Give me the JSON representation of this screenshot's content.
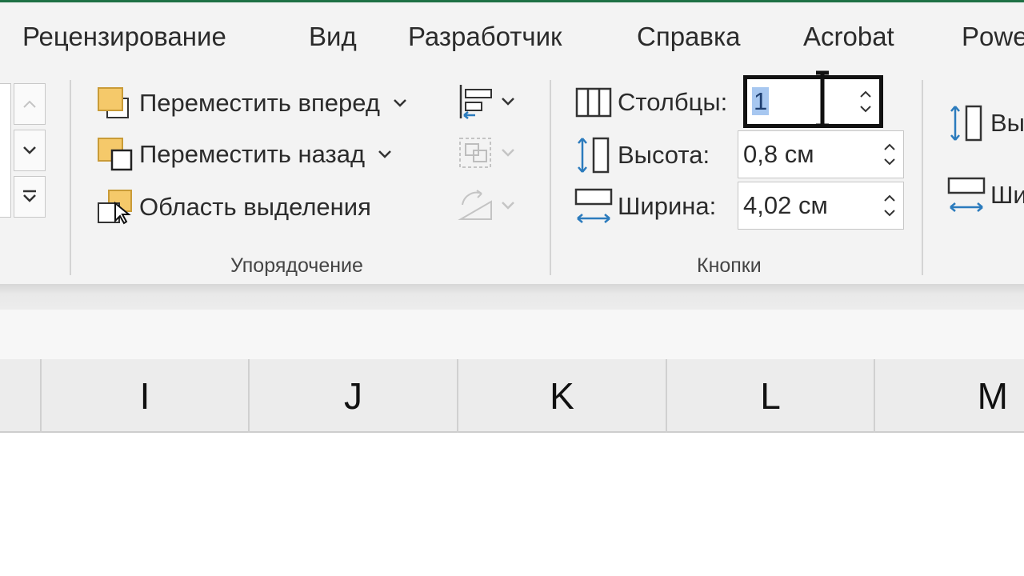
{
  "tabs": [
    "Рецензирование",
    "Вид",
    "Разработчик",
    "Справка",
    "Acrobat",
    "Powe"
  ],
  "arrange": {
    "bring_forward": "Переместить вперед",
    "send_backward": "Переместить назад",
    "selection_pane": "Область выделения",
    "group_label": "Упорядочение"
  },
  "buttons_group": {
    "columns_label": "Столбцы:",
    "columns_value": "1",
    "height_label": "Высота:",
    "height_value": "0,8 см",
    "width_label": "Ширина:",
    "width_value": "4,02 см",
    "group_label": "Кнопки"
  },
  "size_group": {
    "height_label_partial": "Вы",
    "width_label_partial": "Ши"
  },
  "columns": [
    "I",
    "J",
    "K",
    "L",
    "M"
  ],
  "colors": {
    "accent": "#1e7145",
    "ribbon_bg": "#f3f3f3",
    "icon_gold": "#f5c96a",
    "icon_blue": "#2b7bbd",
    "selection": "#a7c7f0"
  }
}
